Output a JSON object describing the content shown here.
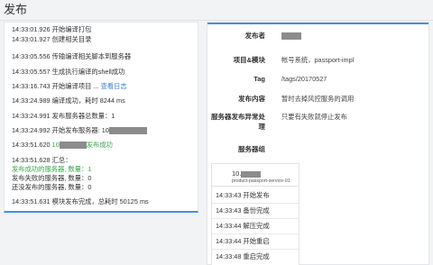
{
  "page": {
    "title": "发布"
  },
  "log": {
    "lines": [
      {
        "text": "14:33:01.926 开始编译打包"
      },
      {
        "text": "14:33:01.927 创建相关目录"
      },
      {
        "text": "14:33:05.556 传输编译相关脚本到服务器"
      },
      {
        "text": "14:33:05.557 生成执行编译的shell成功"
      },
      {
        "text": "14:33:16.743 开始编译项目 ...",
        "link": "查看日志"
      },
      {
        "text": "14:33:24.989 编译成功，耗时 8244 ms"
      },
      {
        "text": "14:33:24.991 发布服务器总数量：1"
      },
      {
        "text": "14:33:24.992 开始发布服务器: 10"
      },
      {
        "text": "14:33:51.620 ",
        "green": "10",
        "green2": "发布成功"
      },
      {
        "text": "14:33:51.628 汇总："
      },
      {
        "text": "发布成功的服务器, 数量：1",
        "color": "green"
      },
      {
        "text": "发布失败的服务器, 数量：0"
      },
      {
        "text": "还没发布的服务器, 数量：0"
      },
      {
        "text": "14:33:51.631 模块发布完成，总耗时 50125 ms"
      }
    ]
  },
  "detail": {
    "publisher_label": "发布者",
    "project_label": "项目&模块",
    "project_value": "帐号系统，passport-impl",
    "tag_label": "Tag",
    "tag_value": "/tags/20170527",
    "content_label": "发布内容",
    "content_value": "暂时去掉风控服务的调用",
    "exception_label_1": "服务器发布异常处",
    "exception_label_2": "理",
    "exception_value": "只要有失败就停止发布",
    "servers_label": "服务器组"
  },
  "server": {
    "name": "10.",
    "sub": "product-passport-service-01",
    "steps": [
      "14:33:43 开始发布",
      "14:33:43 备份完成",
      "14:33:44 解压完成",
      "14:33:44 开始重启",
      "14:33:48 重启完成"
    ]
  }
}
